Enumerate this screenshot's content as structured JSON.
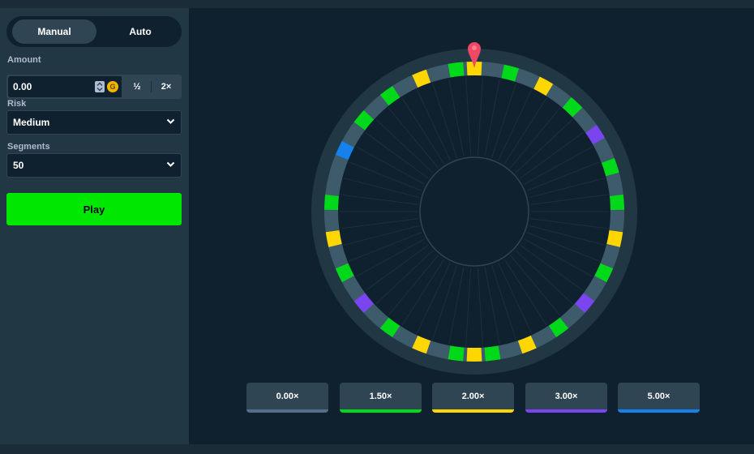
{
  "controls": {
    "mode_manual": "Manual",
    "mode_auto": "Auto",
    "amount_label": "Amount",
    "amount_value": "0.00",
    "currency_symbol": "G",
    "half_label": "½",
    "double_label": "2×",
    "risk_label": "Risk",
    "risk_value": "Medium",
    "segments_label": "Segments",
    "segments_value": "50",
    "play_label": "Play"
  },
  "wheel": {
    "segments": 50,
    "pattern": [
      "yellow",
      "gray",
      "green",
      "gray",
      "yellow",
      "gray",
      "green",
      "gray",
      "purple",
      "gray",
      "green",
      "gray",
      "green",
      "gray",
      "yellow",
      "gray",
      "green",
      "gray",
      "purple",
      "gray",
      "green",
      "gray",
      "yellow",
      "gray",
      "green",
      "yellow",
      "green",
      "gray",
      "yellow",
      "gray",
      "green",
      "gray",
      "purple",
      "gray",
      "green",
      "gray",
      "yellow",
      "gray",
      "green",
      "gray",
      "gray",
      "blue",
      "gray",
      "green",
      "gray",
      "green",
      "gray",
      "yellow",
      "gray",
      "green"
    ],
    "colors": {
      "gray": "#3e5b6b",
      "green": "#00d81a",
      "yellow": "#ffd600",
      "purple": "#7a44ef",
      "blue": "#1481ed"
    }
  },
  "multipliers": [
    {
      "label": "0.00×",
      "color": "#557086"
    },
    {
      "label": "1.50×",
      "color": "#00d81a"
    },
    {
      "label": "2.00×",
      "color": "#ffd600"
    },
    {
      "label": "3.00×",
      "color": "#7a44ef"
    },
    {
      "label": "5.00×",
      "color": "#1481ed"
    }
  ],
  "icons": {
    "pointer": "map-pin-icon",
    "coin": "coin-icon",
    "stepper": "stepper-icon",
    "select_arrow": "chevron-down-icon"
  },
  "accent": "#00e701"
}
